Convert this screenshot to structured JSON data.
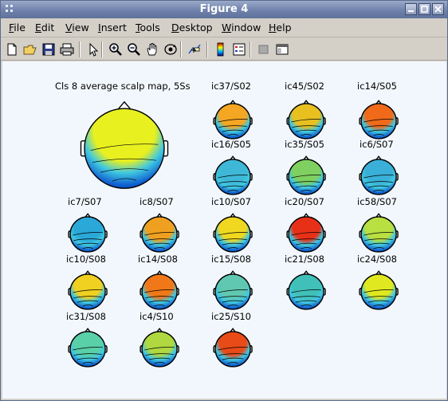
{
  "window": {
    "title": "Figure 4"
  },
  "menu": [
    {
      "label": "File",
      "key": "F",
      "rest": "ile"
    },
    {
      "label": "Edit",
      "key": "E",
      "rest": "dit"
    },
    {
      "label": "View",
      "key": "V",
      "rest": "iew"
    },
    {
      "label": "Insert",
      "key": "I",
      "rest": "nsert"
    },
    {
      "label": "Tools",
      "key": "T",
      "rest": "ools"
    },
    {
      "label": "Desktop",
      "key": "D",
      "rest": "esktop"
    },
    {
      "label": "Window",
      "key": "W",
      "rest": "indow"
    },
    {
      "label": "Help",
      "key": "H",
      "rest": "elp"
    }
  ],
  "toolbar": {
    "icons": [
      "new-figure-icon",
      "open-file-icon",
      "save-icon",
      "print-icon",
      "select-arrow-icon",
      "zoom-in-icon",
      "zoom-out-icon",
      "pan-hand-icon",
      "rotate-3d-icon",
      "data-cursor-icon",
      "colorbar-icon",
      "legend-icon",
      "plot-browser-icon",
      "property-editor-icon"
    ]
  },
  "figure": {
    "main_title": "Cls 8 average scalp map, 5Ss",
    "maps": [
      {
        "label": "ic37/S02",
        "color": "#f5a623"
      },
      {
        "label": "ic45/S02",
        "color": "#e8c020"
      },
      {
        "label": "ic14/S05",
        "color": "#f06a1a"
      },
      {
        "label": "ic16/S05",
        "color": "#3fb8d8"
      },
      {
        "label": "ic35/S05",
        "color": "#7fd060"
      },
      {
        "label": "ic6/S07",
        "color": "#3ab0d8"
      },
      {
        "label": "ic7/S07",
        "color": "#2aa8d8"
      },
      {
        "label": "ic8/S07",
        "color": "#f0a020"
      },
      {
        "label": "ic10/S07",
        "color": "#f0d820"
      },
      {
        "label": "ic20/S07",
        "color": "#e83018"
      },
      {
        "label": "ic58/S07",
        "color": "#b8e040"
      },
      {
        "label": "ic10/S08",
        "color": "#f0d020"
      },
      {
        "label": "ic14/S08",
        "color": "#f07818"
      },
      {
        "label": "ic15/S08",
        "color": "#60c8b0"
      },
      {
        "label": "ic21/S08",
        "color": "#40c0b8"
      },
      {
        "label": "ic24/S08",
        "color": "#e0e820"
      },
      {
        "label": "ic31/S08",
        "color": "#5ad0a8"
      },
      {
        "label": "ic4/S10",
        "color": "#b0d840"
      },
      {
        "label": "ic25/S10",
        "color": "#e84a18"
      }
    ]
  }
}
